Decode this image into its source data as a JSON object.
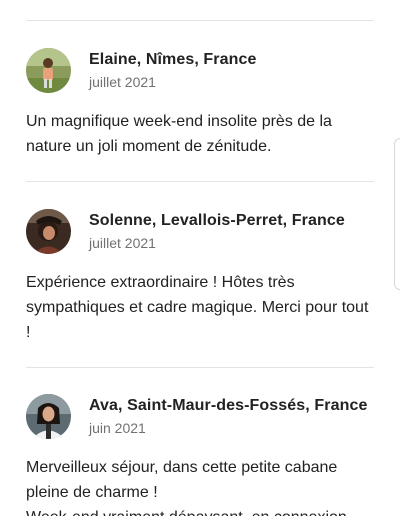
{
  "reviews": [
    {
      "name": "Elaine, Nîmes, France",
      "date": "juillet 2021",
      "text": "Un magnifique week-end insolite près de la nature un joli moment de zénitude.",
      "avatar_icon": "avatar-photo"
    },
    {
      "name": "Solenne, Levallois-Perret, France",
      "date": "juillet 2021",
      "text": "Expérience extraordinaire ! Hôtes très sympathiques et cadre magique. Merci pour tout !",
      "avatar_icon": "avatar-photo"
    },
    {
      "name": "Ava, Saint-Maur-des-Fossés, France",
      "date": "juin 2021",
      "text": "Merveilleux séjour, dans cette petite cabane pleine de charme !\nWeek-end vraiment dépaysant, en connexion",
      "avatar_icon": "avatar-photo"
    }
  ],
  "colors": {
    "text": "#222222",
    "muted": "#717171",
    "divider": "#e4e4e4"
  }
}
